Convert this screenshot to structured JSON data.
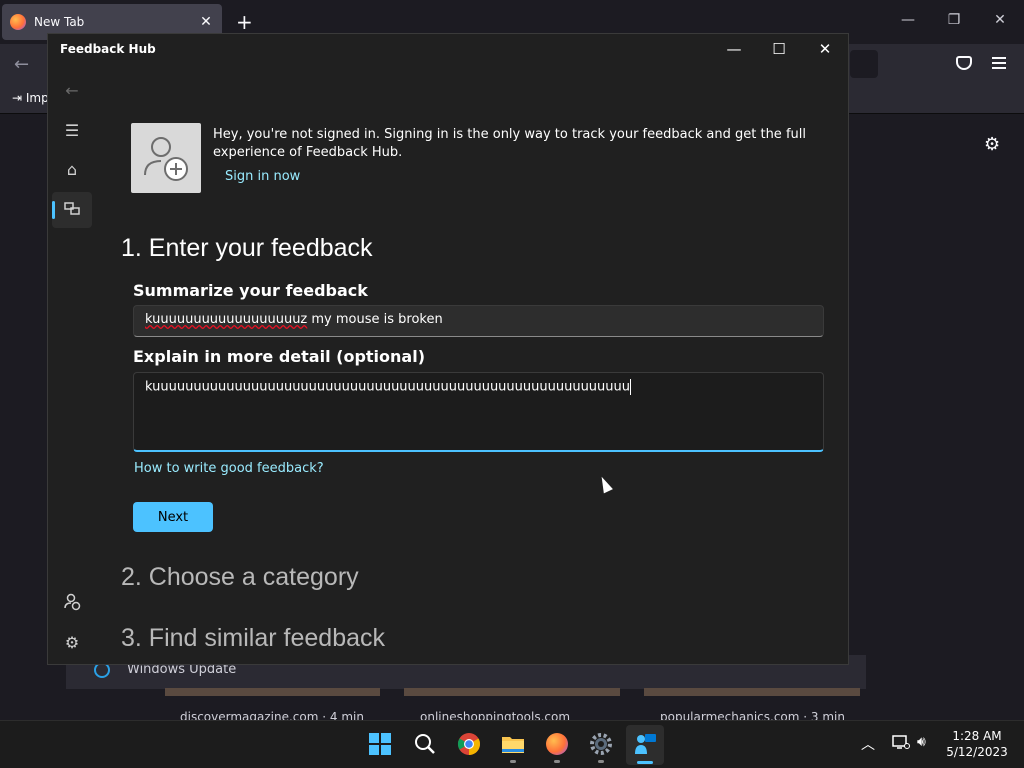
{
  "browser": {
    "tab_title": "New Tab",
    "tab_close": "✕",
    "new_tab": "+",
    "bookmark_import": "Imp",
    "windows_update": "Windows Update",
    "sites": [
      "discovermagazine.com · 4 min",
      "onlineshoppingtools.com",
      "popularmechanics.com · 3 min"
    ]
  },
  "feedback_hub": {
    "window_title": "Feedback Hub",
    "signin_message": "Hey, you're not signed in. Signing in is the only way to track your feedback and get the full experience of Feedback Hub.",
    "signin_link": "Sign in now",
    "step1_title": "1. Enter your feedback",
    "summary_label": "Summarize your feedback",
    "summary_value_typo": "kuuuuuuuuuuuuuuuuuuz",
    "summary_value_rest": " my mouse is broken",
    "detail_label": "Explain in more detail (optional)",
    "detail_value": "kuuuuuuuuuuuuuuuuuuuuuuuuuuuuuuuuuuuuuuuuuuuuuuuuuuuuuuuuuu",
    "howto_link": "How to write good feedback?",
    "next_button": "Next",
    "step2_title": "2. Choose a category",
    "step3_title": "3. Find similar feedback"
  },
  "taskbar": {
    "time": "1:28 AM",
    "date": "5/12/2023"
  },
  "colors": {
    "accent": "#4cc2ff",
    "link": "#99ebff",
    "window_bg": "#202020"
  }
}
